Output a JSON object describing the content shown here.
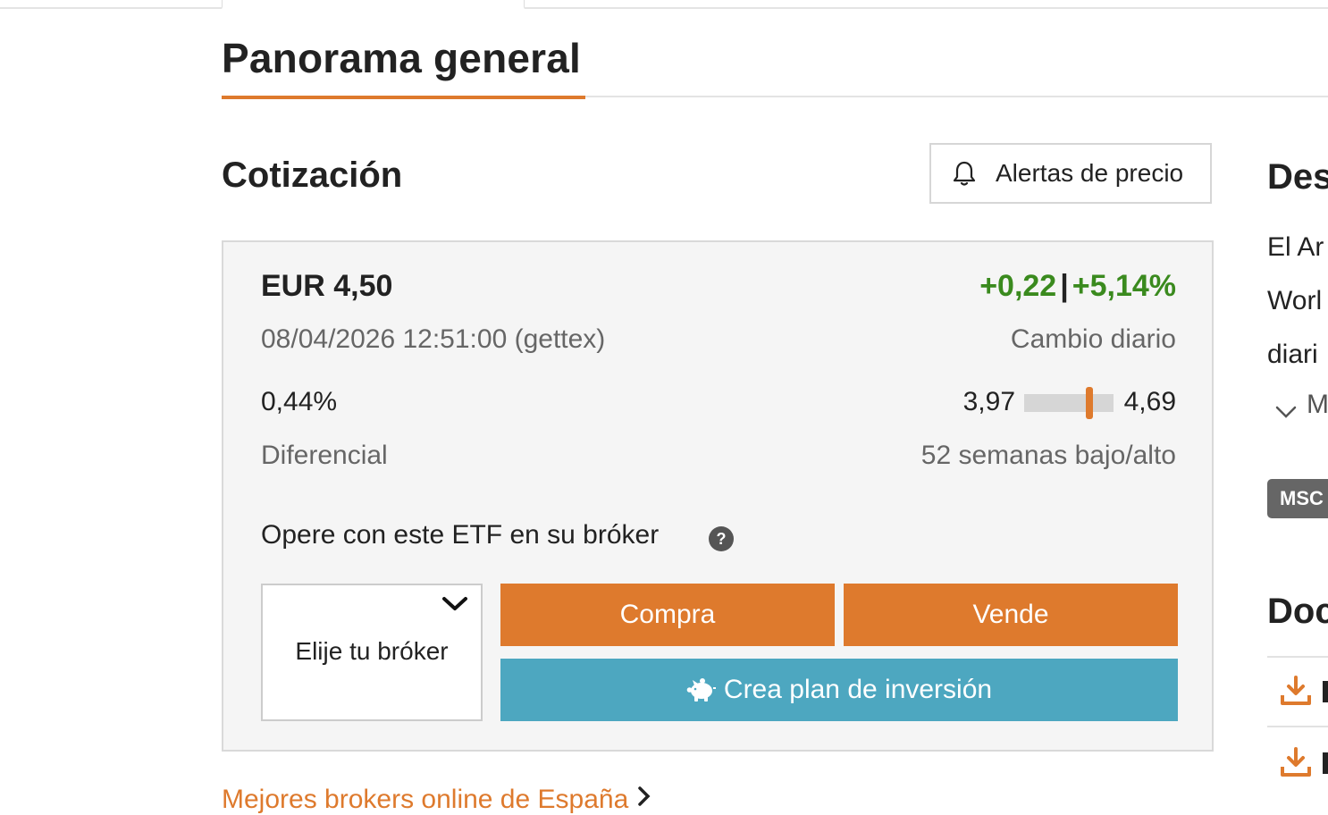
{
  "page": {
    "title": "Panorama general"
  },
  "quote": {
    "section_title": "Cotización",
    "alert_button": "Alertas de precio",
    "price": "EUR 4,50",
    "change_abs": "+0,22",
    "change_sep": "|",
    "change_pct": "+5,14%",
    "datetime": "08/04/2026 12:51:00 (gettex)",
    "daily_change_label": "Cambio diario",
    "spread_value": "0,44%",
    "spread_label": "Diferencial",
    "range_low": "3,97",
    "range_high": "4,69",
    "range_label": "52 semanas bajo/alto",
    "range_position": 0.73,
    "trade_label": "Opere con este ETF en su bróker",
    "help_icon_glyph": "?",
    "broker_placeholder": "Elije tu bróker",
    "buy_button": "Compra",
    "sell_button": "Vende",
    "plan_button": "Crea plan de inversión"
  },
  "links": {
    "best_brokers": "Mejores brokers online de España"
  },
  "sidebar": {
    "description_title": "Des",
    "description_lines": [
      "El Ar",
      "Worl",
      "diari"
    ],
    "more_label": "M",
    "tag": "MSC",
    "documents_title": "Doc"
  },
  "colors": {
    "accent_orange": "#de7a2d",
    "positive_green": "#3a8a1e",
    "plan_blue": "#4da7c0",
    "box_background": "#f5f5f5"
  },
  "icons": {
    "alert": "bell-icon",
    "help": "question-circle-icon",
    "broker_select": "chevron-down-icon",
    "plan": "piggy-bank-icon",
    "link": "chevron-right-icon",
    "more": "chevron-down-icon",
    "documents": "download-icon"
  }
}
